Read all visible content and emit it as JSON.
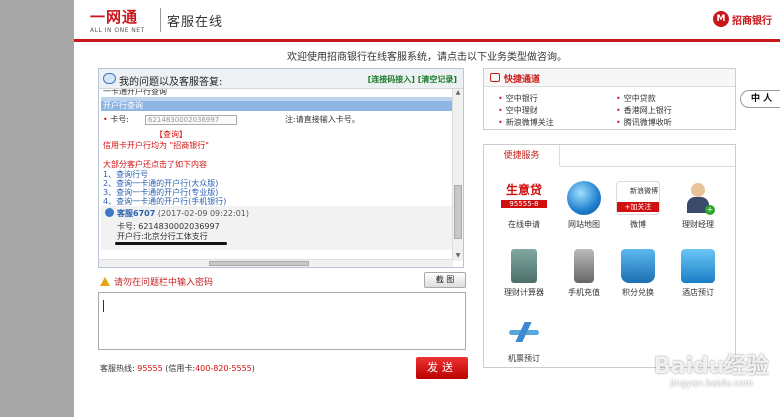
{
  "header": {
    "logo_text": "一网通",
    "logo_sub": "ALL IN ONE NET",
    "service_title": "客服在线",
    "bank_name": "招商银行"
  },
  "welcome": "欢迎使用招商银行在线客服系统，请点击以下业务类型做咨询。",
  "chat_panel": {
    "title": "我的问题以及客服答复:",
    "link_continue": "[连接码接入]",
    "link_clear": "[清空记录]",
    "lines": {
      "top_cut": "一卡通开户行查询",
      "section": "开户行查询",
      "card_label": "卡号:",
      "card_value": "6214830002036997",
      "hint": "注:请直接输入卡号。",
      "query_btn": "【查询】",
      "credit_note": "信用卡开户行均为 \"招商银行\"",
      "most_users": "大部分客户还点击了如下内容",
      "opt1": "1、查询行号",
      "opt2": "2、查询一卡通的开户行(大众版)",
      "opt3": "3、查询一卡通的开户行(专业版)",
      "opt4": "4、查询一卡通的开户行(手机银行)",
      "agent": "客服6707",
      "time": "(2017-02-09 09:22:01)",
      "reply_card": "卡号: 6214830002036997",
      "reply_branch": "开户行:北京分行工体支行"
    }
  },
  "warn_text": "请勿在问题栏中输入密码",
  "screenshot_btn": "截 图",
  "hotline": {
    "label": "客服热线:",
    "num1": "95555",
    "credit": "(信用卡:",
    "num2": "400-820-5555",
    "close": ")"
  },
  "send_label": "发送",
  "quick": {
    "title": "快捷通道",
    "items": [
      "空中银行",
      "空中贷款",
      "空中理财",
      "香港网上银行",
      "新浪微博关注",
      "腾讯微博收听"
    ]
  },
  "convenient": {
    "tab": "便捷服务",
    "tiles": [
      {
        "label": "在线申请",
        "icon": "loan-apply-icon",
        "badge": "生意贷",
        "badge_sub": "95555-8"
      },
      {
        "label": "网站地图",
        "icon": "sitemap-icon"
      },
      {
        "label": "微博",
        "icon": "weibo-icon",
        "badge": "新浪微博",
        "badge_sub": "+加关注"
      },
      {
        "label": "理财经理",
        "icon": "manager-icon"
      },
      {
        "label": "理财计算器",
        "icon": "calculator-icon"
      },
      {
        "label": "手机充值",
        "icon": "phone-topup-icon"
      },
      {
        "label": "积分兑换",
        "icon": "points-icon"
      },
      {
        "label": "酒店预订",
        "icon": "hotel-icon"
      },
      {
        "label": "机票预订",
        "icon": "flight-icon"
      }
    ]
  },
  "side_tab": "中 人",
  "watermark": {
    "main": "Baidu经验",
    "sub": "jingyan.baidu.com"
  },
  "colors": {
    "brand_red": "#c8161d",
    "link_green": "#1a7a2a",
    "link_blue": "#2a5fb0"
  }
}
